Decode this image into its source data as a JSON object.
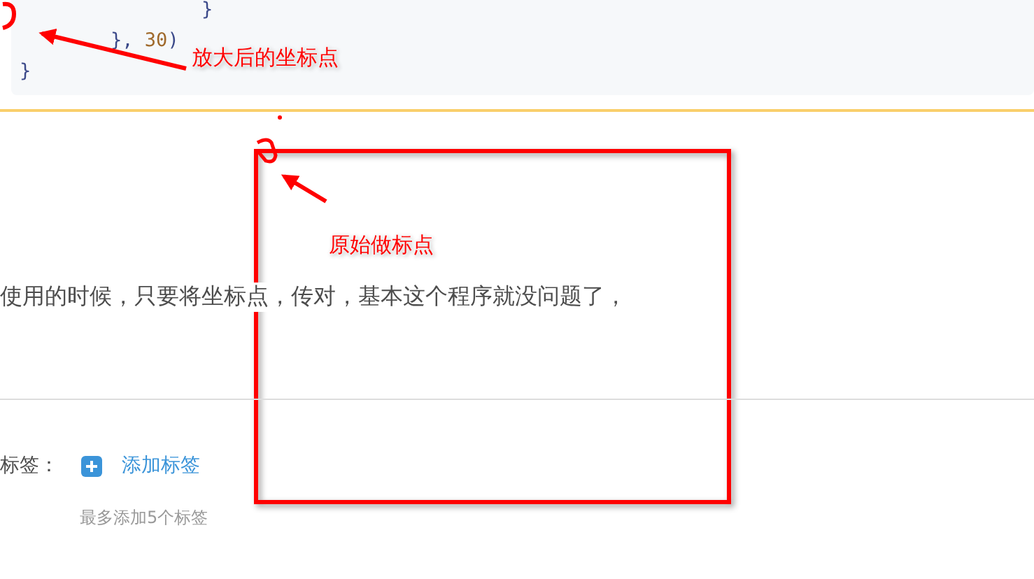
{
  "code_block": {
    "lines": [
      {
        "tokens": [
          {
            "text": "                }",
            "kind": "punct"
          }
        ]
      },
      {
        "tokens": [
          {
            "text": "        }, ",
            "kind": "punct"
          },
          {
            "text": "30",
            "kind": "number"
          },
          {
            "text": ")",
            "kind": "punct"
          }
        ]
      },
      {
        "tokens": [
          {
            "text": "}",
            "kind": "punct"
          }
        ]
      }
    ]
  },
  "paragraph": "使用的时候，只要将坐标点，传对，基本这个程序就没问题了，",
  "tags": {
    "label": "标签：",
    "add_link": "添加标签",
    "hint": "最多添加5个标签"
  },
  "annotations": [
    {
      "kind": "label",
      "text": "放大后的坐标点"
    },
    {
      "kind": "label",
      "text": "原始做标点"
    }
  ]
}
